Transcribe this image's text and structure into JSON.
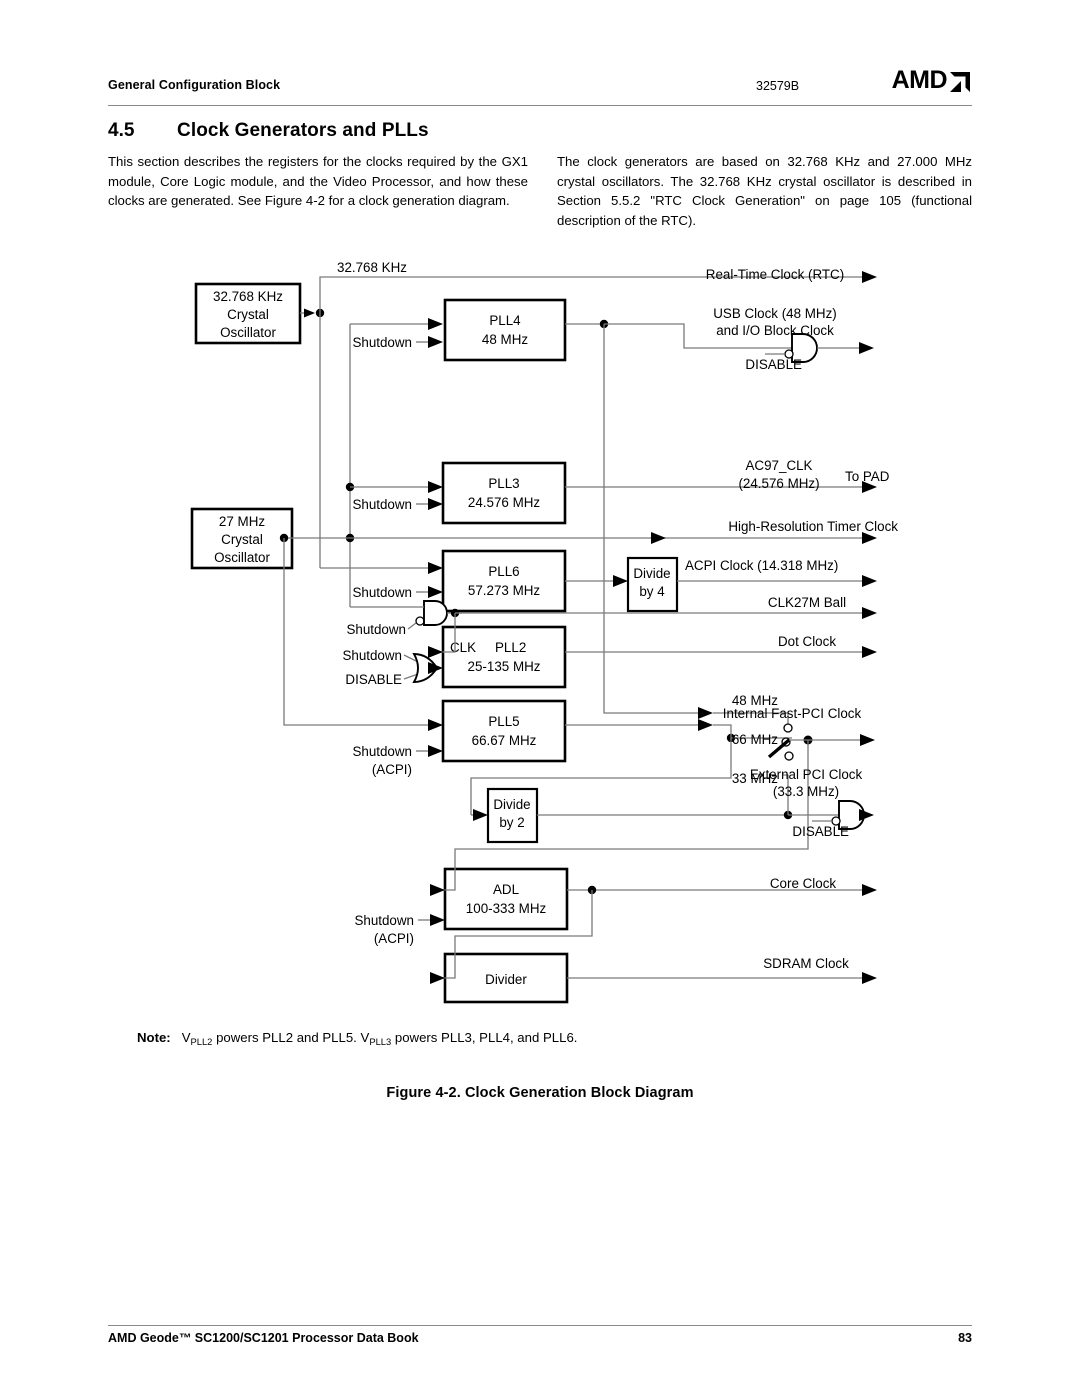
{
  "header": {
    "left_title": "General Configuration Block",
    "doc_number": "32579B",
    "logo_text": "AMD",
    "logo_icon": "amd-arrow-icon"
  },
  "section": {
    "number": "4.5",
    "title": "Clock Generators and PLLs"
  },
  "body": {
    "left_paragraph": "This section describes the registers for the clocks required by the GX1 module, Core Logic module, and the Video Processor, and how these clocks are generated. See Figure 4-2 for a clock generation diagram.",
    "right_paragraph": "The clock generators are based on 32.768 KHz and 27.000 MHz crystal oscillators. The 32.768 KHz crystal oscillator is described in Section 5.5.2 \"RTC Clock Generation\" on page 105 (functional description of the RTC)."
  },
  "note": {
    "label": "Note:",
    "text_1": "V",
    "sub_1": "PLL2",
    "text_2": " powers PLL2 and PLL5. V",
    "sub_2": "PLL3",
    "text_3": " powers PLL3, PLL4, and PLL6."
  },
  "figure": {
    "caption": "Figure 4-2.  Clock Generation Block Diagram"
  },
  "footer": {
    "left": "AMD Geode™ SC1200/SC1201 Processor Data Book",
    "page_number": "83"
  },
  "diagram": {
    "blocks": [
      {
        "id": "osc32k",
        "lines": [
          "32.768 KHz",
          "Crystal",
          "Oscillator"
        ]
      },
      {
        "id": "osc27m",
        "lines": [
          "27 MHz",
          "Crystal",
          "Oscillator"
        ]
      },
      {
        "id": "pll4",
        "lines": [
          "PLL4",
          "48 MHz"
        ]
      },
      {
        "id": "pll3",
        "lines": [
          "PLL3",
          "24.576 MHz"
        ]
      },
      {
        "id": "pll6",
        "lines": [
          "PLL6",
          "57.273 MHz"
        ]
      },
      {
        "id": "pll2",
        "lines": [
          "25-135 MHz"
        ],
        "clk_label": "CLK",
        "name_label": "PLL2"
      },
      {
        "id": "pll5",
        "lines": [
          "PLL5",
          "66.67 MHz"
        ]
      },
      {
        "id": "adl",
        "lines": [
          "ADL",
          "100-333 MHz"
        ]
      },
      {
        "id": "divider",
        "lines": [
          "Divider"
        ]
      },
      {
        "id": "div4",
        "lines": [
          "Divide",
          "by 4"
        ]
      },
      {
        "id": "div2",
        "lines": [
          "Divide",
          "by 2"
        ]
      }
    ],
    "input_labels": {
      "bus_32768": "32.768 KHz",
      "shutdown_pll4": "Shutdown",
      "shutdown_pll3": "Shutdown",
      "shutdown_pll6": "Shutdown",
      "shutdown_gate_and": "Shutdown",
      "shutdown_gate_or": "Shutdown",
      "disable_pll2": "DISABLE",
      "shutdown_pll5": "Shutdown",
      "shutdown_pll5_2": "(ACPI)",
      "shutdown_adl": "Shutdown",
      "shutdown_adl_2": "(ACPI)"
    },
    "outputs": [
      {
        "id": "rtc",
        "label": "Real-Time Clock (RTC)"
      },
      {
        "id": "usb",
        "label_1": "USB Clock (48 MHz)",
        "label_2": "and I/O Block Clock",
        "gate_label": "DISABLE"
      },
      {
        "id": "ac97",
        "label_1": "AC97_CLK",
        "label_2": "(24.576 MHz)",
        "pad": "To PAD"
      },
      {
        "id": "hrtimer",
        "label": "High-Resolution Timer Clock"
      },
      {
        "id": "acpi",
        "label": "ACPI Clock (14.318 MHz)"
      },
      {
        "id": "clk27m",
        "label": "CLK27M Ball"
      },
      {
        "id": "dot",
        "label": "Dot Clock"
      },
      {
        "id": "fastpci",
        "label": "Internal Fast-PCI Clock"
      },
      {
        "id": "extpci",
        "label_1": "External PCI Clock",
        "label_2": "(33.3 MHz)",
        "gate_label": "DISABLE"
      },
      {
        "id": "core",
        "label": "Core Clock"
      },
      {
        "id": "sdram",
        "label": "SDRAM Clock"
      }
    ],
    "mux_labels": {
      "in_48": "48 MHz",
      "in_66": "66 MHz",
      "in_33": "33 MHz"
    },
    "colors": {
      "wire": "#7a7a7a",
      "box_stroke": "#000000",
      "text": "#000000"
    }
  }
}
